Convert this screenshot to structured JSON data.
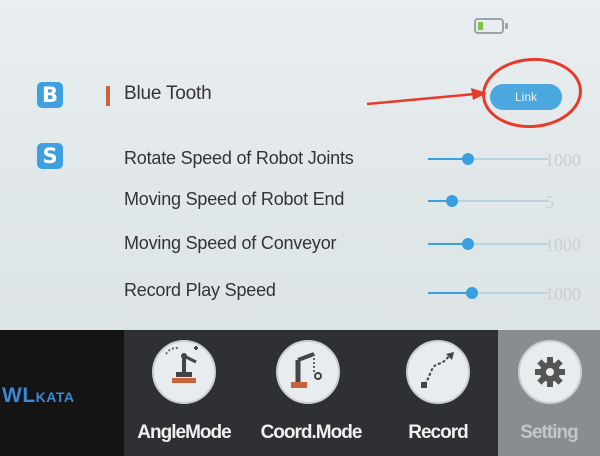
{
  "colors": {
    "accent": "#3ea0e0",
    "highlight_circle": "#e63a2a",
    "battery_level": "#7fc241"
  },
  "status": {
    "battery_icon": "battery-low-icon"
  },
  "bluetooth": {
    "section_letter": "B",
    "label": "Blue Tooth",
    "link_label": "Link"
  },
  "speed": {
    "section_letter": "S",
    "rows": [
      {
        "label": "Rotate Speed of Robot Joints",
        "value": "1000",
        "slider_fraction": 0.33
      },
      {
        "label": "Moving Speed of Robot End",
        "value": "5",
        "slider_fraction": 0.2
      },
      {
        "label": "Moving Speed of Conveyor",
        "value": "1000",
        "slider_fraction": 0.33
      },
      {
        "label": "Record Play Speed",
        "value": "1000",
        "slider_fraction": 0.37
      }
    ]
  },
  "nav": {
    "logo_text": "WL",
    "logo_text_small": "KATA",
    "buttons": [
      {
        "label": "AngleMode",
        "icon": "robot-arm-angle-icon"
      },
      {
        "label": "Coord.Mode",
        "icon": "robot-arm-coord-icon"
      },
      {
        "label": "Record",
        "icon": "record-path-icon"
      },
      {
        "label": "Setting",
        "icon": "gear-icon"
      }
    ]
  }
}
